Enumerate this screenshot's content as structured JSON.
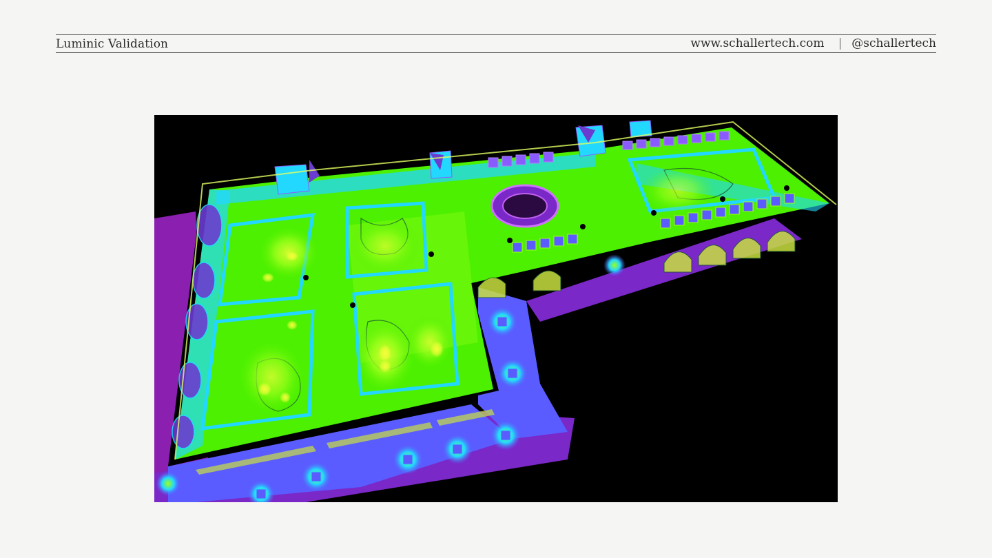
{
  "header": {
    "title": "Luminic Validation",
    "website": "www.schallertech.com",
    "separator": "|",
    "handle": "@schallertech"
  },
  "image": {
    "description_icon": "false-color-illuminance-floor-plan",
    "palette": {
      "background": "#000000",
      "green": "#4cf000",
      "lime": "#9cff1a",
      "cyan": "#22d8ff",
      "blue": "#5a5cff",
      "violet": "#7a28c8",
      "magenta": "#9a1aa8",
      "yellow": "#f4ff3a"
    }
  }
}
